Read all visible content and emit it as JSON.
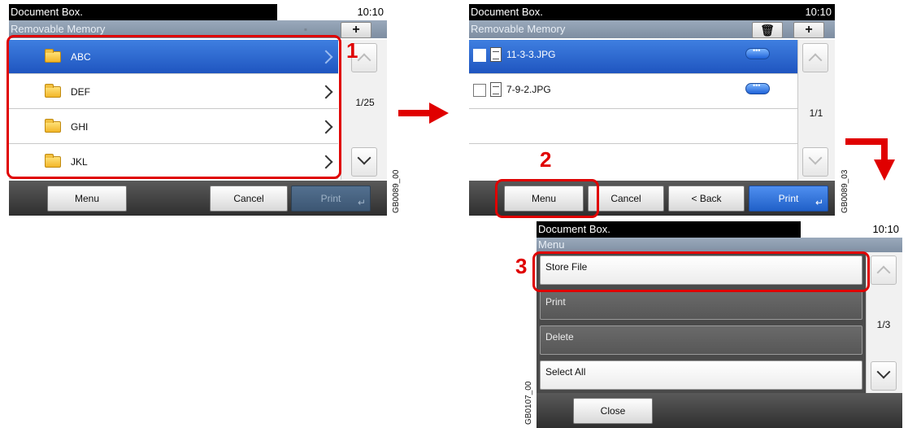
{
  "screen1": {
    "title": "Document Box.",
    "time": "10:10",
    "subtitle": "Removable Memory",
    "add_icon": "+",
    "folders": [
      {
        "label": "ABC",
        "selected": true
      },
      {
        "label": "DEF",
        "selected": false
      },
      {
        "label": "GHI",
        "selected": false
      },
      {
        "label": "JKL",
        "selected": false
      }
    ],
    "page": "1/25",
    "buttons": {
      "menu": "Menu",
      "cancel": "Cancel",
      "print": "Print"
    },
    "image_code": "GB0089_00"
  },
  "screen2": {
    "title": "Document Box.",
    "time": "10:10",
    "subtitle": "Removable Memory",
    "add_icon": "+",
    "files": [
      {
        "label": "11-3-3.JPG",
        "selected": true
      },
      {
        "label": "7-9-2.JPG",
        "selected": false
      }
    ],
    "page": "1/1",
    "buttons": {
      "menu": "Menu",
      "cancel": "Cancel",
      "back": "< Back",
      "print": "Print"
    },
    "image_code": "GB0089_03"
  },
  "screen3": {
    "title": "Document Box.",
    "time": "10:10",
    "subtitle": "Menu",
    "items": [
      {
        "label": "Store File"
      },
      {
        "label": "Print"
      },
      {
        "label": "Delete"
      },
      {
        "label": "Select All"
      }
    ],
    "page": "1/3",
    "buttons": {
      "close": "Close"
    },
    "image_code": "GB0107_00"
  },
  "steps": {
    "one": "1",
    "two": "2",
    "three": "3"
  },
  "colors": {
    "callout": "#e00000",
    "arrow": "#e00000",
    "selected_row": "#2a63cc"
  }
}
